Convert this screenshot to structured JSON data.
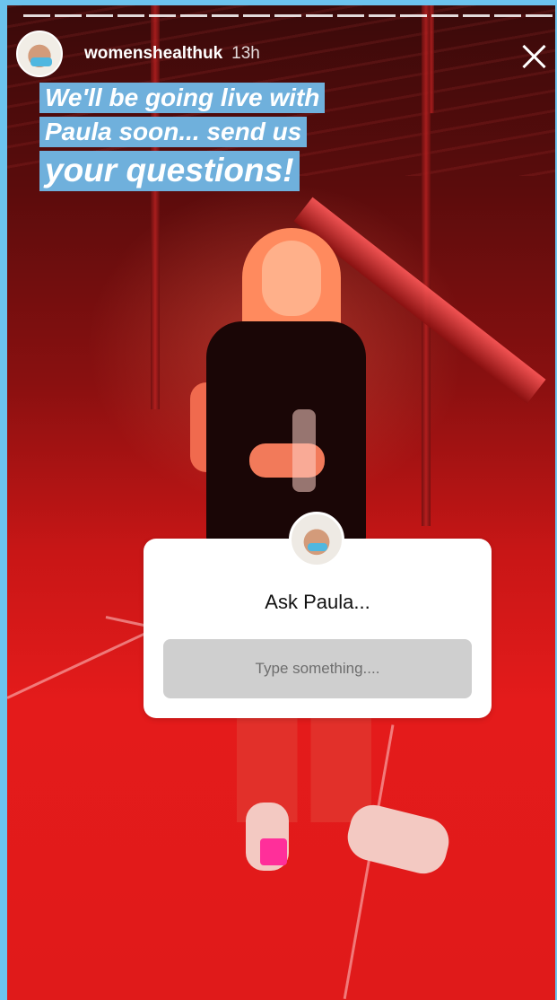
{
  "header": {
    "username": "womenshealthuk",
    "time_ago": "13h"
  },
  "caption": {
    "lines": [
      "We'll be going live with",
      "Paula soon... send us",
      "your questions!"
    ]
  },
  "question_sticker": {
    "prompt": "Ask Paula...",
    "placeholder": "Type something...."
  },
  "colors": {
    "caption_highlight": "#6fb0dc",
    "frame": "#6cc3ee"
  }
}
